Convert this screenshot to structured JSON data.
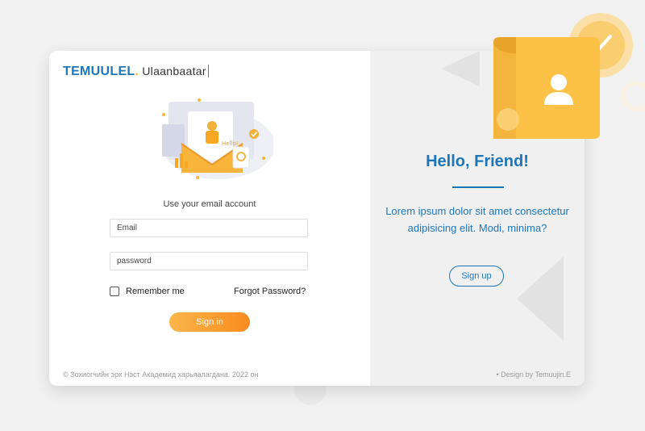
{
  "brand": {
    "name": "TEMUULEL",
    "dot": ".",
    "city": "Ulaanbaatar"
  },
  "login": {
    "subtitle": "Use your email account",
    "email_placeholder": "Email",
    "password_placeholder": "password",
    "remember_label": "Remember me",
    "forgot_label": "Forgot Password?",
    "signin_label": "Sign in",
    "illustration_text": "Hello!"
  },
  "footer": {
    "copyright": "© Зохиогчийн эрх Нэст Академид харьяалагдана. 2022 он",
    "design": "• Design by Temuujin.E"
  },
  "welcome": {
    "title": "Hello, Friend!",
    "description": "Lorem ipsum dolor sit amet consectetur adipisicing elit. Modi, minima?",
    "signup_label": "Sign up"
  },
  "colors": {
    "accent": "#1e76b9",
    "orange": "#f98a1f",
    "yellow": "#fbc04a"
  },
  "icons": [
    "user-icon",
    "check-icon"
  ]
}
